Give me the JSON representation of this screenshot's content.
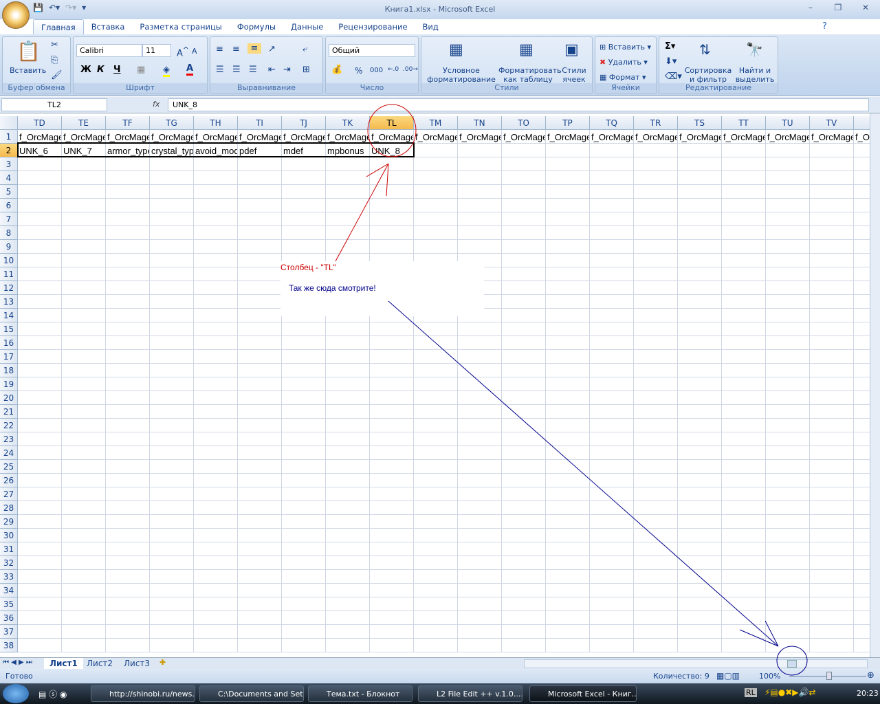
{
  "window": {
    "title": "Книга1.xlsx - Microsoft Excel"
  },
  "tabs": [
    "Главная",
    "Вставка",
    "Разметка страницы",
    "Формулы",
    "Данные",
    "Рецензирование",
    "Вид"
  ],
  "ribbon": {
    "clipboard": {
      "label": "Буфер обмена",
      "paste": "Вставить"
    },
    "font": {
      "label": "Шрифт",
      "name": "Calibri",
      "size": "11",
      "bold": "Ж",
      "italic": "К",
      "underline": "Ч"
    },
    "alignment": {
      "label": "Выравнивание"
    },
    "number": {
      "label": "Число",
      "format": "Общий",
      "percent": "%",
      "thousands": "000"
    },
    "styles": {
      "label": "Стили",
      "conditional": "Условное форматирование",
      "format_table": "Форматировать как таблицу",
      "cell_styles": "Стили ячеек"
    },
    "cells": {
      "label": "Ячейки",
      "insert": "Вставить",
      "delete": "Удалить",
      "format": "Формат"
    },
    "editing": {
      "label": "Редактирование",
      "sort": "Сортировка и фильтр",
      "find": "Найти и выделить"
    }
  },
  "formula_bar": {
    "name_box": "TL2",
    "fx": "fx",
    "value": "UNK_8"
  },
  "columns": [
    "TD",
    "TE",
    "TF",
    "TG",
    "TH",
    "TI",
    "TJ",
    "TK",
    "TL",
    "TM",
    "TN",
    "TO",
    "TP",
    "TQ",
    "TR",
    "TS",
    "TT",
    "TU",
    "TV",
    ""
  ],
  "selected_column": "TL",
  "rows": [
    "1",
    "2",
    "3",
    "4",
    "5",
    "6",
    "7",
    "8",
    "9",
    "10",
    "11",
    "12",
    "13",
    "14",
    "15",
    "16",
    "17",
    "18",
    "19",
    "20",
    "21",
    "22",
    "23",
    "24",
    "25",
    "26",
    "27",
    "28",
    "29",
    "30",
    "31",
    "32",
    "33",
    "34",
    "35",
    "36",
    "37",
    "38"
  ],
  "row1": [
    "f_OrcMage",
    "f_OrcMage",
    "f_OrcMage",
    "f_OrcMage",
    "f_OrcMage",
    "f_OrcMage",
    "f_OrcMage",
    "f_OrcMage",
    "f_OrcMage",
    "f_OrcMage",
    "f_OrcMage",
    "f_OrcMage",
    "f_OrcMage",
    "f_OrcMage",
    "f_OrcMage",
    "f_OrcMage",
    "f_OrcMage",
    "f_OrcMage",
    "f_OrcMage",
    "f_OrcMage"
  ],
  "row2": [
    "UNK_6",
    "UNK_7",
    "armor_type",
    "crystal_type",
    "avoid_modify",
    "pdef",
    "mdef",
    "mpbonus",
    "UNK_8"
  ],
  "annotations": {
    "column_label": "Столбец - \"TL\"",
    "look_here": "Так же сюда смотрите!",
    "red": "#cc0000",
    "blue": "#00008b"
  },
  "sheets": [
    "Лист1",
    "Лист2",
    "Лист3"
  ],
  "status": {
    "ready": "Готово",
    "count": "Количество: 9",
    "zoom": "100%"
  },
  "taskbar": {
    "items": [
      "http://shinobi.ru/news...",
      "C:\\Documents and Set...",
      "Тема.txt - Блокнот",
      "L2 File Edit ++ v.1.0....",
      "Microsoft Excel - Книг..."
    ],
    "lang": "RL",
    "clock": "20:23"
  }
}
